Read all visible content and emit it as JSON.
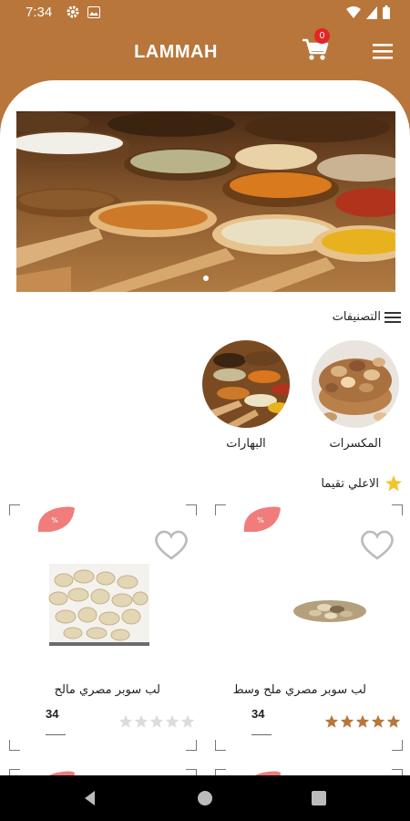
{
  "status_bar": {
    "time": "7:34"
  },
  "app_bar": {
    "title": "LAMMAH",
    "cart_count": "0"
  },
  "categories": {
    "header": "التصنيفات",
    "items": [
      {
        "label": "المكسرات",
        "icon": "nuts-photo"
      },
      {
        "label": "البهارات",
        "icon": "spices-photo"
      }
    ]
  },
  "top_rated": {
    "header": "الاعلي تقيما",
    "products": [
      {
        "name": "لب سوبر مصري ملح وسط",
        "price": "34",
        "rating": 5,
        "discount_badge": "%"
      },
      {
        "name": "لب سوبر مصري مالح",
        "price": "34",
        "rating": 0,
        "discount_badge": "%"
      }
    ]
  },
  "colors": {
    "brand": "#b8763a",
    "badge": "#e32626",
    "discount": "#f07c7c",
    "star": "#b8763a"
  }
}
